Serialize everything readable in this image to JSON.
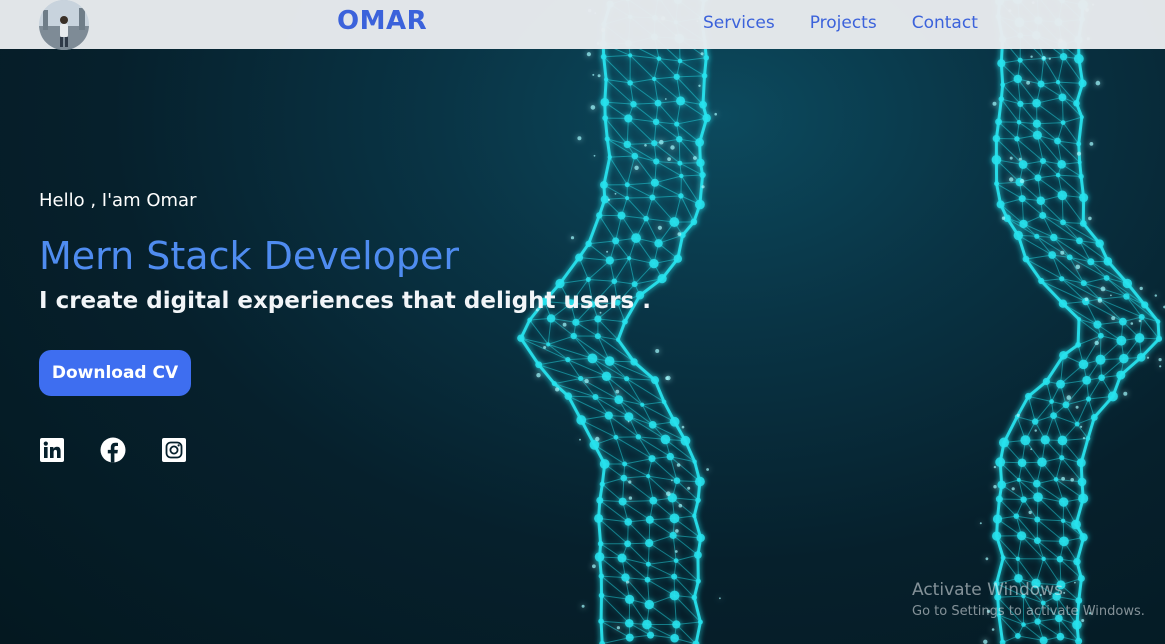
{
  "header": {
    "brand": "OMAR",
    "nav": [
      "Services",
      "Projects",
      "Contact"
    ]
  },
  "hero": {
    "greeting": "Hello , I'am Omar",
    "role": "Mern Stack Developer",
    "tagline": "I create digital experiences that delight users .",
    "cv_button": "Download CV"
  },
  "socials": [
    {
      "icon": "linkedin-icon"
    },
    {
      "icon": "facebook-icon"
    },
    {
      "icon": "instagram-icon"
    }
  ],
  "watermark": {
    "title": "Activate Windows",
    "subtitle": "Go to Settings to activate Windows."
  },
  "colors": {
    "accent": "#3b62db",
    "role_text": "#4f8cf0",
    "button": "#3e6ef0",
    "neon": "#27e3ee",
    "background": "#06202c"
  }
}
